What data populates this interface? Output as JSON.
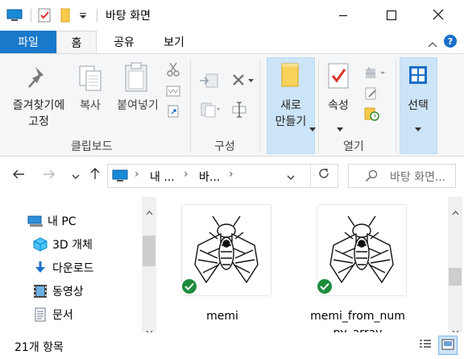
{
  "window": {
    "title": "바탕 화면",
    "minimize_icon": "minimize-icon",
    "maximize_icon": "maximize-icon",
    "close_icon": "close-icon"
  },
  "ribbon_tabs": {
    "file": "파일",
    "home": "홈",
    "share": "공유",
    "view": "보기"
  },
  "ribbon": {
    "clipboard": {
      "pin_label_1": "즐겨찾기에",
      "pin_label_2": "고정",
      "copy": "복사",
      "paste": "붙여넣기",
      "group_label": "클립보드"
    },
    "organize": {
      "group_label": "구성"
    },
    "new": {
      "new_folder_label_1": "새로",
      "new_folder_label_2": "만들기"
    },
    "open": {
      "properties_label": "속성",
      "group_label": "열기"
    },
    "select": {
      "label": "선택"
    }
  },
  "address": {
    "segment_1": "내 ...",
    "segment_2": "바...",
    "search_placeholder": "바탕 화면..."
  },
  "nav_pane": {
    "items": [
      {
        "label": "내 PC",
        "icon": "pc-icon"
      },
      {
        "label": "3D 개체",
        "icon": "3d-objects-icon"
      },
      {
        "label": "다운로드",
        "icon": "download-icon"
      },
      {
        "label": "동영상",
        "icon": "video-icon"
      },
      {
        "label": "문서",
        "icon": "document-icon"
      }
    ]
  },
  "files": [
    {
      "name_line_1": "memi",
      "name_line_2": ""
    },
    {
      "name_line_1": "memi_from_num",
      "name_line_2": "py_array"
    }
  ],
  "status": {
    "item_count": "21개 항목"
  },
  "colors": {
    "accent": "#1979ca",
    "ribbon_bg": "#f5f6f7",
    "sync_badge": "#1e8c3c",
    "highlight": "#cce4f7"
  }
}
